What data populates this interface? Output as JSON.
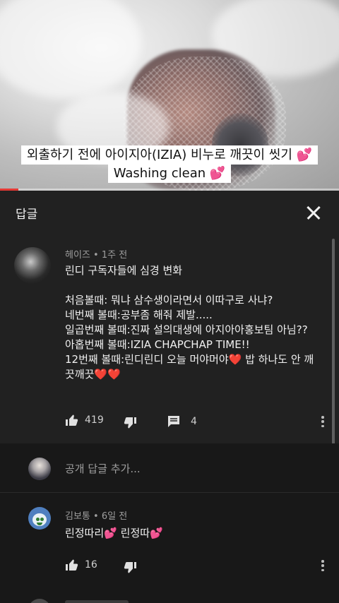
{
  "video": {
    "caption_line1": "외출하기 전에 아이지아(IZIA) 비누로 깨끗이 씻기 💕",
    "caption_line2": "Washing clean 💕",
    "progress": 0.055,
    "progress_color": "#e53935"
  },
  "header": {
    "title": "답글",
    "close_icon": "close-icon"
  },
  "parent_comment": {
    "author": "헤이즈",
    "time": "1주 전",
    "body": "린디 구독자들에 심경 변화\n\n처음볼때: 뭐냐 삼수생이라면서 이따구로 사냐?\n네번째 볼때:공부좀 해줘 제발.....\n일곱번째 볼때:진짜 설의대생에 아지아아홍보팀 아님??\n아홉번째 볼때:IZIA CHAPCHAP TIME!!\n12번째 볼때:린디린디 오늘 머야머야❤️ 밥 하나도 안 깨끗깨끗❤️❤️",
    "likes": "419",
    "replies": "4"
  },
  "add_reply": {
    "placeholder": "공개 답글 추가..."
  },
  "reply": {
    "author": "김보통",
    "time": "6일 전",
    "body": "린정따리💕 린정따💕",
    "likes": "16"
  },
  "meta_separator": "•"
}
